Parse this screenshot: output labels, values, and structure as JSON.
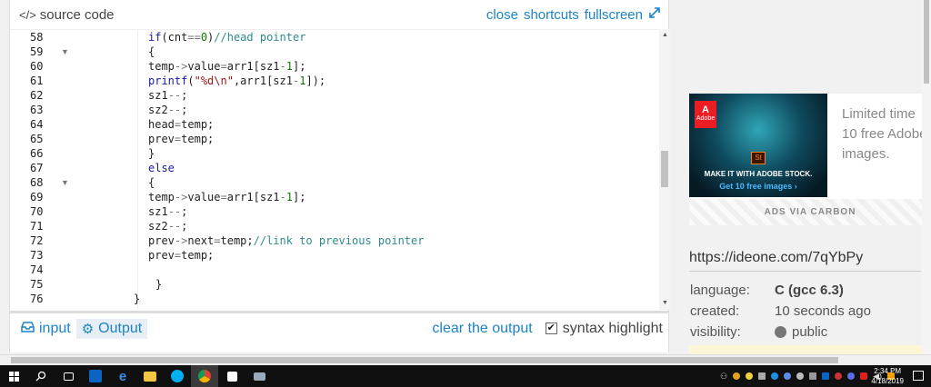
{
  "editor": {
    "title": "source code",
    "header_links": {
      "close": "close",
      "shortcuts": "shortcuts",
      "fullscreen": "fullscreen"
    },
    "lines": [
      {
        "n": "58",
        "fold": false
      },
      {
        "n": "59",
        "fold": true
      },
      {
        "n": "60",
        "fold": false
      },
      {
        "n": "61",
        "fold": false
      },
      {
        "n": "62",
        "fold": false
      },
      {
        "n": "63",
        "fold": false
      },
      {
        "n": "64",
        "fold": false
      },
      {
        "n": "65",
        "fold": false
      },
      {
        "n": "66",
        "fold": false
      },
      {
        "n": "67",
        "fold": false
      },
      {
        "n": "68",
        "fold": true
      },
      {
        "n": "69",
        "fold": false
      },
      {
        "n": "70",
        "fold": false
      },
      {
        "n": "71",
        "fold": false
      },
      {
        "n": "72",
        "fold": false
      },
      {
        "n": "73",
        "fold": false
      },
      {
        "n": "74",
        "fold": false
      },
      {
        "n": "75",
        "fold": false
      },
      {
        "n": "76",
        "fold": false
      }
    ],
    "code": [
      "if(cnt==0)//head pointer",
      "{",
      "temp->value=arr1[sz1-1];",
      "printf(\"%d\\n\",arr1[sz1-1]);",
      "sz1--;",
      "sz2--;",
      "head=temp;",
      "prev=temp;",
      "}",
      "else",
      "{",
      "temp->value=arr1[sz1-1];",
      "sz1--;",
      "sz2--;",
      "prev->next=temp;//link to previous pointer",
      "prev=temp;",
      "",
      "}",
      "}"
    ]
  },
  "io": {
    "input_tab": "input",
    "output_tab": "Output",
    "clear_output": "clear the output",
    "syntax_highlight": "syntax highlight",
    "syntax_checked": true
  },
  "ad": {
    "adobe_label": "Adobe",
    "badge": "St",
    "headline": "MAKE IT WITH ADOBE STOCK.",
    "sub": "Get 10 free images ›",
    "text_lines": [
      "Limited time",
      "10 free Adobe",
      "images."
    ],
    "via": "ADS VIA CARBON"
  },
  "paste": {
    "url": "https://ideone.com/7qYbPy",
    "language_label": "language:",
    "language_value": "C (gcc 6.3)",
    "created_label": "created:",
    "created_value": "10 seconds ago",
    "visibility_label": "visibility:",
    "visibility_value": "public"
  },
  "taskbar": {
    "time": "2:34 PM",
    "date": "4/18/2019"
  },
  "colors": {
    "link": "#1c84c6",
    "taskbar": "#101010"
  }
}
